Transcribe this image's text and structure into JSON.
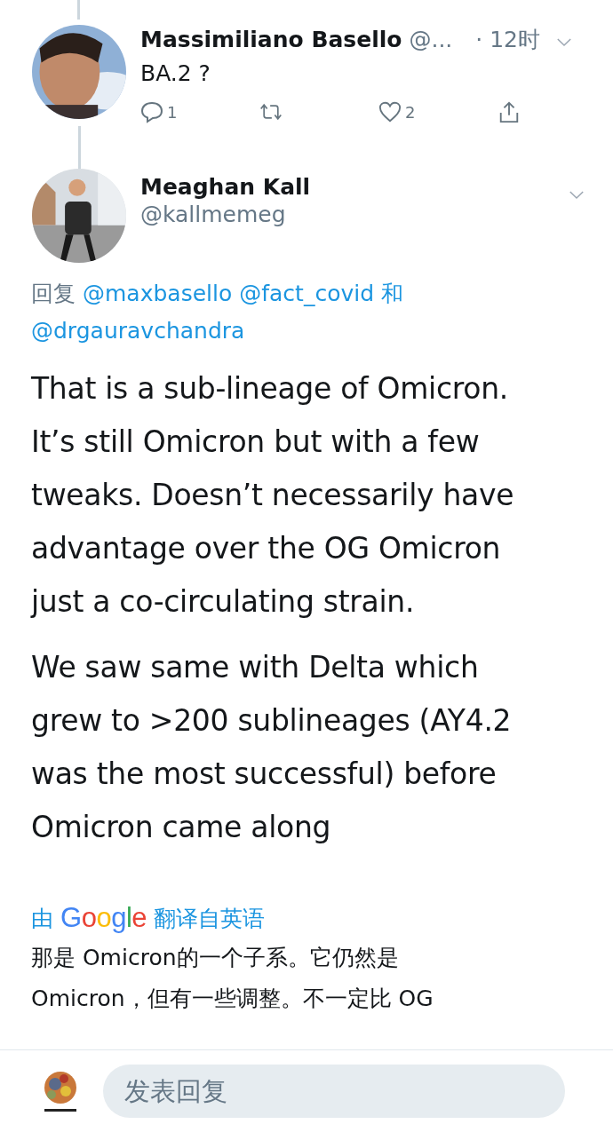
{
  "parent_tweet": {
    "name": "Massimiliano Basello",
    "handle": "@...",
    "time": "· 12时",
    "text": "BA.2 ?",
    "actions": [
      {
        "kind": "reply",
        "count": "1"
      },
      {
        "kind": "retweet"
      },
      {
        "kind": "like",
        "count": "2"
      },
      {
        "kind": "share"
      }
    ]
  },
  "main_tweet": {
    "name": "Meaghan Kall",
    "handle": "@kallmemeg",
    "reply_prefix": "回复",
    "mentions": [
      "@maxbasello",
      "@fact_covid"
    ],
    "conjunction": "和",
    "last_mention": "@drgauravchandra",
    "paragraphs": [
      [
        "That is a sub-lineage of Omicron.",
        "It’s still Omicron but with a few",
        "tweaks. Doesn’t necessarily have",
        "advantage over the OG Omicron",
        "just a co-circulating strain."
      ],
      [
        "We saw same with Delta which",
        "grew to >200 sublineages (AY4.2",
        "was the most successful) before",
        "Omicron came along"
      ]
    ],
    "translation": {
      "prefix": "由",
      "brand": "Google",
      "suffix": "翻译自英语",
      "lines": [
        "那是 Omicron的一个子系。它仍然是",
        "Omicron，但有一些调整。不一定比 OG"
      ]
    }
  },
  "reply_bar": {
    "placeholder": "发表回复"
  }
}
